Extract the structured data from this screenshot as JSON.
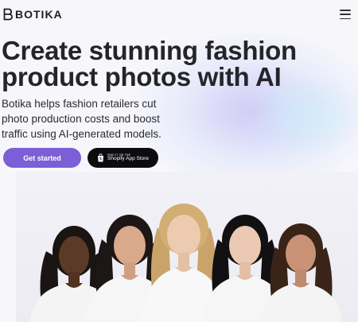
{
  "header": {
    "brand": "BOTIKA",
    "logo_icon": "botika-logo-icon",
    "menu_icon": "hamburger-menu-icon"
  },
  "hero": {
    "title_line1": "Create stunning fashion",
    "title_line2": "product photos with AI",
    "subtitle_line1": "Botika helps fashion retailers cut",
    "subtitle_line2": "photo production costs and boost",
    "subtitle_line3": "traffic using AI-generated models.",
    "cta_label": "Get started",
    "shopify_small": "FIND IT ON THE",
    "shopify_label": "Shopify App Store"
  },
  "colors": {
    "accent": "#7a5fd6",
    "dark_button": "#0c0c0e",
    "text": "#252529"
  }
}
